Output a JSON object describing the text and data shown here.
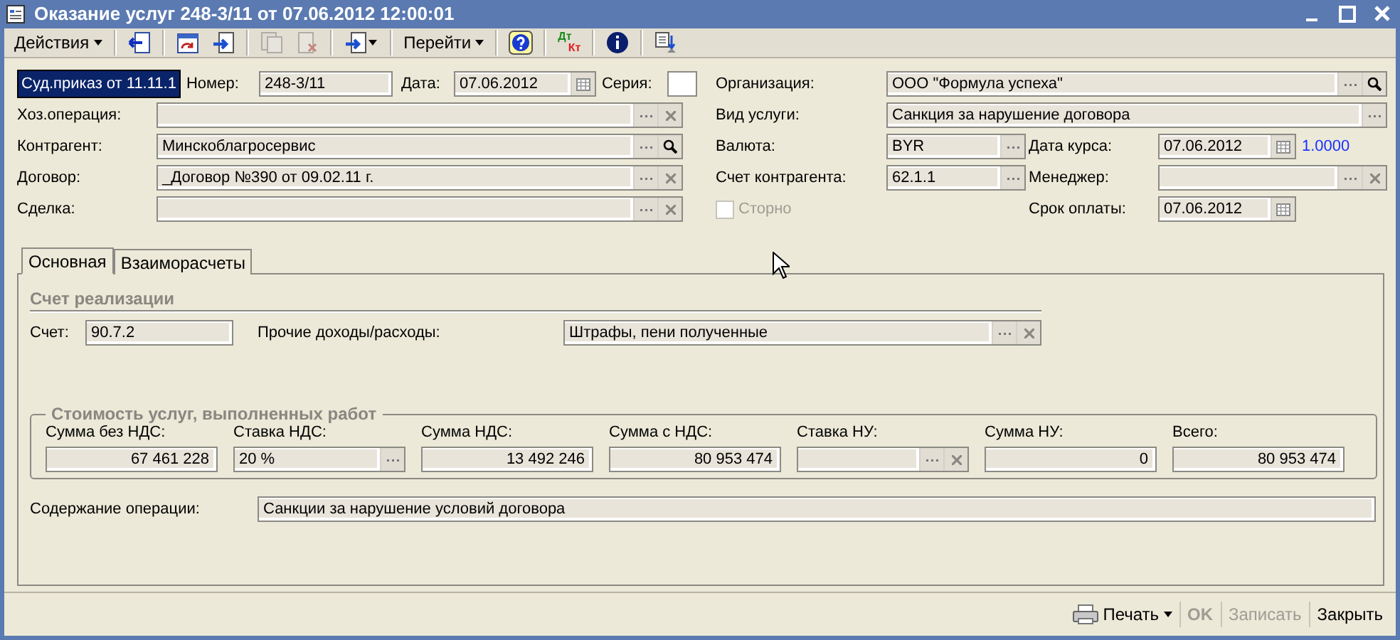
{
  "window": {
    "title": "Оказание услуг 248-3/11 от 07.06.2012 12:00:01"
  },
  "toolbar": [
    {
      "kind": "menu",
      "label": "Действия"
    },
    {
      "kind": "separator"
    },
    {
      "kind": "icon",
      "disabled": false
    },
    {
      "kind": "separator"
    },
    {
      "kind": "icon",
      "disabled": false
    },
    {
      "kind": "icon",
      "disabled": false
    },
    {
      "kind": "separator"
    },
    {
      "kind": "icon",
      "disabled": true
    },
    {
      "kind": "icon",
      "disabled": true
    },
    {
      "kind": "separator"
    },
    {
      "kind": "icon-menu",
      "disabled": false
    },
    {
      "kind": "separator"
    },
    {
      "kind": "menu",
      "label": "Перейти"
    },
    {
      "kind": "separator"
    },
    {
      "kind": "icon",
      "disabled": false
    },
    {
      "kind": "separator"
    },
    {
      "kind": "dtkt",
      "top": "Дт",
      "bottom": "Кт"
    },
    {
      "kind": "separator"
    },
    {
      "kind": "icon",
      "disabled": false
    },
    {
      "kind": "separator"
    },
    {
      "kind": "icon",
      "disabled": false
    }
  ],
  "header": {
    "document_kind": {
      "value": "Суд.приказ от 11.11.1",
      "selected": true
    },
    "number": {
      "label": "Номер:",
      "value": "248-3/11"
    },
    "date": {
      "label": "Дата:",
      "value": "07.06.2012"
    },
    "series": {
      "label": "Серия:"
    },
    "left_fields": [
      {
        "label": "Хоз.операция:",
        "kind": "choose-clear"
      },
      {
        "label": "Контрагент:",
        "value": "Минскоблагросервис",
        "kind": "choose-search"
      },
      {
        "label": "Договор:",
        "value": "_Договор №390 от 09.02.11 г.",
        "kind": "choose-clear"
      },
      {
        "label": "Сделка:",
        "kind": "choose-clear"
      }
    ],
    "organization": {
      "label": "Организация:",
      "value": "ООО \"Формула успеха\"",
      "kind": "choose-search"
    },
    "service_type": {
      "label": "Вид услуги:",
      "value": "Санкция за нарушение договора",
      "kind": "choose"
    },
    "currency": {
      "label": "Валюта:",
      "value": "BYR",
      "kind": "choose"
    },
    "rate_date": {
      "label": "Дата курса:",
      "value": "07.06.2012",
      "kind": "date"
    },
    "rate": "1.0000",
    "counterparty_account": {
      "label": "Счет контрагента:",
      "value": "62.1.1",
      "kind": "choose"
    },
    "manager": {
      "label": "Менеджер:",
      "kind": "choose-clear"
    },
    "storno": {
      "label": "Сторно",
      "checked": false,
      "disabled": true
    },
    "payment_due": {
      "label": "Срок оплаты:",
      "value": "07.06.2012",
      "kind": "date"
    }
  },
  "tabs": [
    {
      "label": "Основная",
      "selected": true
    },
    {
      "label": "Взаиморасчеты",
      "selected": false
    }
  ],
  "sales_account": {
    "title": "Счет реализации",
    "account": {
      "label": "Счет:",
      "value": "90.7.2"
    },
    "other_income": {
      "label": "Прочие доходы/расходы:",
      "value": "Штрафы, пени полученные",
      "kind": "choose-clear"
    }
  },
  "cost": {
    "title": "Стоимость услуг, выполненных работ",
    "columns": [
      {
        "label": "Сумма без НДС:",
        "value": "67 461 228",
        "kind": "number"
      },
      {
        "label": "Ставка НДС:",
        "value": "20 %",
        "kind": "choose"
      },
      {
        "label": "Сумма НДС:",
        "value": "13 492 246",
        "kind": "number"
      },
      {
        "label": "Сумма с НДС:",
        "value": "80 953 474",
        "kind": "number"
      },
      {
        "label": "Ставка НУ:",
        "kind": "choose-clear"
      },
      {
        "label": "Сумма НУ:",
        "value": "0",
        "kind": "number"
      },
      {
        "label": "Всего:",
        "value": "80 953 474",
        "kind": "number"
      }
    ]
  },
  "operation_content": {
    "label": "Содержание операции:",
    "value": "Санкции за нарушение условий договора"
  },
  "footer": [
    {
      "label": "Печать",
      "kind": "print-menu",
      "disabled": false
    },
    {
      "label": "OK",
      "kind": "button",
      "disabled": true
    },
    {
      "label": "Записать",
      "kind": "button",
      "disabled": true
    },
    {
      "label": "Закрыть",
      "kind": "button",
      "disabled": false
    }
  ]
}
